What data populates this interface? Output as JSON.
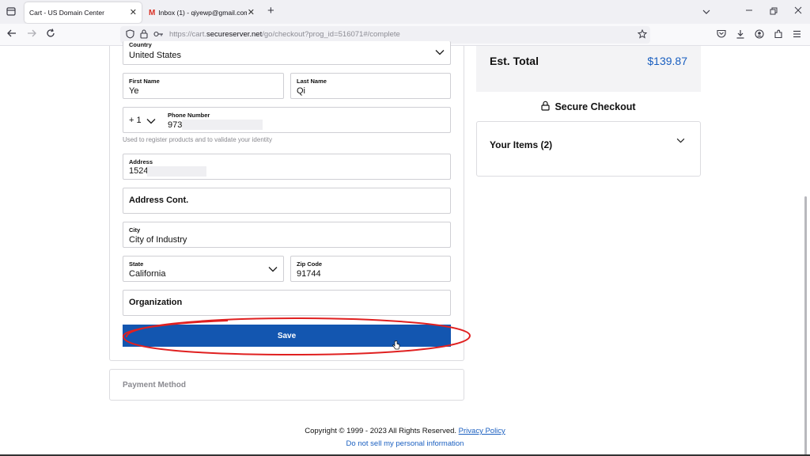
{
  "browser": {
    "tabs": [
      {
        "label": "Cart - US Domain Center",
        "active": true
      },
      {
        "label": "Inbox (1) - qiyewp@gmail.com",
        "active": false
      }
    ],
    "url_prefix": "https://cart.",
    "url_host": "secureserver.net",
    "url_path": "/go/checkout?prog_id=516071#/complete",
    "new_tab_glyph": "+",
    "close_glyph": "✕"
  },
  "form": {
    "country": {
      "label": "Country",
      "value": "United States"
    },
    "first_name": {
      "label": "First Name",
      "value": "Ye"
    },
    "last_name": {
      "label": "Last Name",
      "value": "Qi"
    },
    "phone": {
      "code": "+ 1",
      "label": "Phone Number",
      "value": "973"
    },
    "phone_hint": "Used to register products and to validate your identity",
    "address": {
      "label": "Address",
      "value": "1524"
    },
    "address_cont": {
      "label": "Address Cont."
    },
    "city": {
      "label": "City",
      "value": "City of Industry"
    },
    "state": {
      "label": "State",
      "value": "California"
    },
    "zip": {
      "label": "Zip Code",
      "value": "91744"
    },
    "organization": {
      "label": "Organization"
    },
    "save_label": "Save"
  },
  "payment": {
    "label": "Payment Method"
  },
  "summary": {
    "est_total_label": "Est. Total",
    "est_total_value": "$139.87",
    "secure_checkout": "Secure Checkout",
    "your_items": "Your Items (2)"
  },
  "footer": {
    "copyright": "Copyright © 1999 - 2023 All Rights Reserved.",
    "privacy": "Privacy Policy",
    "do_not_sell": "Do not sell my personal information"
  },
  "colors": {
    "accent": "#1356b0",
    "total": "#1a5fc0",
    "annotation": "#e02020"
  }
}
